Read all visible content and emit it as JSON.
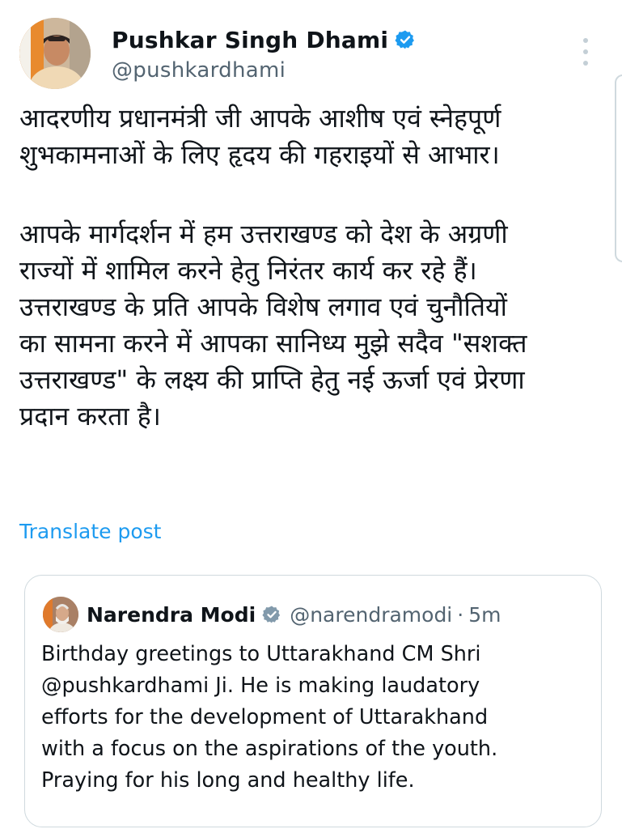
{
  "tweet": {
    "author": {
      "name": "Pushkar Singh Dhami",
      "handle": "@pushkardhami"
    },
    "text_lines": [
      "आदरणीय प्रधानमंत्री जी आपके आशीष एवं स्नेहपूर्ण",
      "शुभकामनाओं के लिए हृदय की गहराइयों से आभार।",
      "आपके मार्गदर्शन में हम उत्तराखण्ड को देश के अग्रणी",
      "राज्यों में शामिल करने हेतु निरंतर कार्य कर रहे हैं।",
      "उत्तराखण्ड के प्रति आपके विशेष लगाव एवं चुनौतियों",
      "का सामना करने में आपका सानिध्य मुझे सदैव \"सशक्त",
      "उत्तराखण्ड\" के लक्ष्य की प्राप्ति हेतु नई ऊर्जा एवं प्रेरणा",
      "प्रदान करता है।"
    ],
    "translate_label": "Translate post"
  },
  "quoted": {
    "name": "Narendra Modi",
    "handle": "@narendramodi",
    "separator": "·",
    "time": "5m",
    "text_lines": [
      "Birthday greetings to Uttarakhand CM Shri",
      "@pushkardhami Ji. He is making laudatory",
      "efforts for the development of Uttarakhand",
      "with a focus on the aspirations of the youth.",
      "Praying for his long and healthy life."
    ]
  },
  "colors": {
    "text": "#0f1419",
    "secondary": "#536471",
    "link": "#1d9bf0",
    "verified_blue": "#1d9bf0",
    "verified_gray": "#829aab",
    "border": "#cfd9de"
  },
  "icons": {
    "verified": "verified-badge-icon",
    "government_verified": "gray-verified-badge-icon",
    "more": "more-vertical-icon"
  }
}
